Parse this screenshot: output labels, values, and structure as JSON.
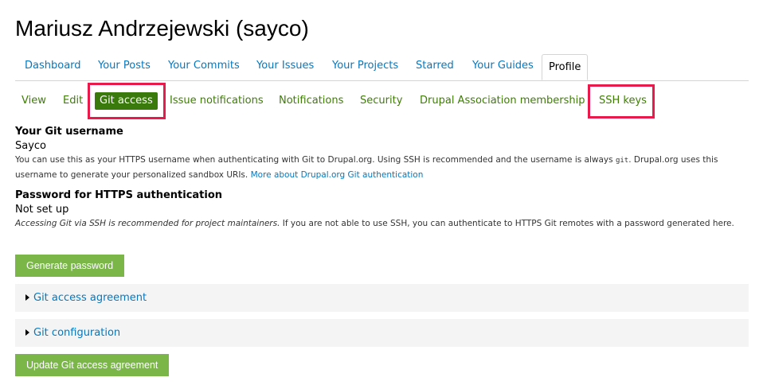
{
  "page": {
    "title": "Mariusz Andrzejewski (sayco)"
  },
  "tabs": [
    {
      "label": "Dashboard"
    },
    {
      "label": "Your Posts"
    },
    {
      "label": "Your Commits"
    },
    {
      "label": "Your Issues"
    },
    {
      "label": "Your Projects"
    },
    {
      "label": "Starred"
    },
    {
      "label": "Your Guides"
    },
    {
      "label": "Profile",
      "active": true
    }
  ],
  "subtabs": [
    {
      "label": "View"
    },
    {
      "label": "Edit"
    },
    {
      "label": "Git access",
      "active": true
    },
    {
      "label": "Issue notifications"
    },
    {
      "label": "Notifications"
    },
    {
      "label": "Security"
    },
    {
      "label": "Drupal Association membership"
    },
    {
      "label": "SSH keys"
    }
  ],
  "git_username": {
    "heading": "Your Git username",
    "value": "Sayco",
    "desc_part1": "You can use this as your HTTPS username when authenticating with Git to Drupal.org. Using SSH is recommended and the username is always ",
    "desc_code": "git",
    "desc_part2": ". Drupal.org uses this username to generate your personalized sandbox URIs. ",
    "desc_link": "More about Drupal.org Git authentication"
  },
  "https_password": {
    "heading": "Password for HTTPS authentication",
    "value": "Not set up",
    "desc_em": "Accessing Git via SSH is recommended for project maintainers.",
    "desc_rest": " If you are not able to use SSH, you can authenticate to HTTPS Git remotes with a password generated here."
  },
  "buttons": {
    "generate": "Generate password",
    "update": "Update Git access agreement"
  },
  "fieldsets": [
    {
      "label": "Git access agreement"
    },
    {
      "label": "Git configuration"
    }
  ],
  "colors": {
    "link_blue": "#0678be",
    "tab_green": "#3f7d07",
    "active_green": "#3a7a0c",
    "button_green": "#7ab648",
    "highlight_red": "#e8194b"
  }
}
